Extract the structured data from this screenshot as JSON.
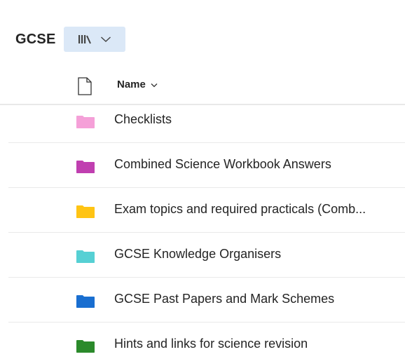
{
  "header": {
    "title": "GCSE",
    "library_icon": "library-icon",
    "dropdown_icon": "chevron-down-icon"
  },
  "columns": {
    "file_type_icon": "document-icon",
    "name_label": "Name",
    "sort_icon": "chevron-down-icon"
  },
  "folders": [
    {
      "name": "Checklists",
      "color": "#f4a0d8"
    },
    {
      "name": "Combined Science Workbook Answers",
      "color": "#c03fb0"
    },
    {
      "name": "Exam topics and required practicals (Comb...",
      "color": "#ffc414"
    },
    {
      "name": "GCSE Knowledge Organisers",
      "color": "#56d0d4"
    },
    {
      "name": "GCSE Past Papers and Mark Schemes",
      "color": "#1a6fd0"
    },
    {
      "name": "Hints and links for science revision",
      "color": "#2b8a2b"
    }
  ]
}
